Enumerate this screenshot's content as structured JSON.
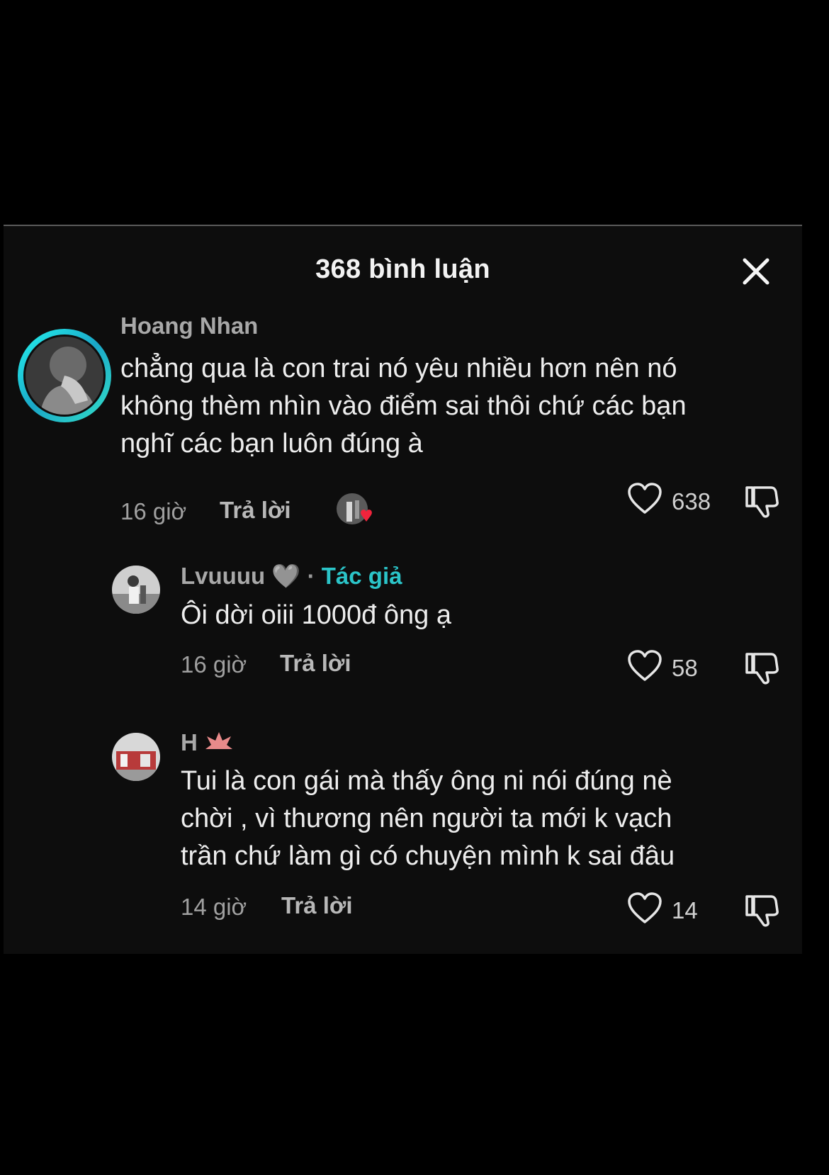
{
  "header": {
    "title": "368 bình luận",
    "close_icon": "close-icon"
  },
  "colors": {
    "background": "#000000",
    "panel": "#0d0d0d",
    "author_tag": "#2bc4c8",
    "ring": "#25f4ee"
  },
  "comments": [
    {
      "username": "Hoang Nhan",
      "lines": [
        "chẳng qua là con trai nó yêu nhiều hơn nên nó",
        "không thèm nhìn vào điểm sai thôi chứ các bạn",
        "nghĩ các bạn luôn đúng à"
      ],
      "time": "16 giờ",
      "reply_label": "Trả lời",
      "likes": "638"
    },
    {
      "username": "Lvuuuu",
      "badge": "🩶",
      "separator": "·",
      "author_label": "Tác giả",
      "lines": [
        "Ôi dời oiii 1000đ ông ạ"
      ],
      "time": "16 giờ",
      "reply_label": "Trả lời",
      "likes": "58"
    },
    {
      "username": "H",
      "lines": [
        "Tui là con gái mà thấy ông ni nói đúng nè",
        "chời , vì thương nên người ta mới k vạch",
        "trần chứ làm gì có chuyện mình k sai đâu"
      ],
      "time": "14 giờ",
      "reply_label": "Trả lời",
      "likes": "14"
    }
  ]
}
